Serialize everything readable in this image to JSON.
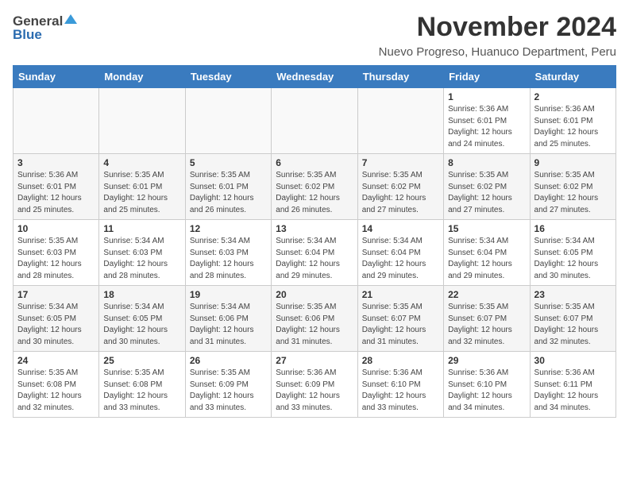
{
  "logo": {
    "general": "General",
    "blue": "Blue"
  },
  "title": "November 2024",
  "location": "Nuevo Progreso, Huanuco Department, Peru",
  "days_of_week": [
    "Sunday",
    "Monday",
    "Tuesday",
    "Wednesday",
    "Thursday",
    "Friday",
    "Saturday"
  ],
  "weeks": [
    [
      {
        "day": "",
        "sunrise": "",
        "sunset": "",
        "daylight": "",
        "empty": true
      },
      {
        "day": "",
        "sunrise": "",
        "sunset": "",
        "daylight": "",
        "empty": true
      },
      {
        "day": "",
        "sunrise": "",
        "sunset": "",
        "daylight": "",
        "empty": true
      },
      {
        "day": "",
        "sunrise": "",
        "sunset": "",
        "daylight": "",
        "empty": true
      },
      {
        "day": "",
        "sunrise": "",
        "sunset": "",
        "daylight": "",
        "empty": true
      },
      {
        "day": "1",
        "sunrise": "Sunrise: 5:36 AM",
        "sunset": "Sunset: 6:01 PM",
        "daylight": "Daylight: 12 hours and 24 minutes."
      },
      {
        "day": "2",
        "sunrise": "Sunrise: 5:36 AM",
        "sunset": "Sunset: 6:01 PM",
        "daylight": "Daylight: 12 hours and 25 minutes."
      }
    ],
    [
      {
        "day": "3",
        "sunrise": "Sunrise: 5:36 AM",
        "sunset": "Sunset: 6:01 PM",
        "daylight": "Daylight: 12 hours and 25 minutes."
      },
      {
        "day": "4",
        "sunrise": "Sunrise: 5:35 AM",
        "sunset": "Sunset: 6:01 PM",
        "daylight": "Daylight: 12 hours and 25 minutes."
      },
      {
        "day": "5",
        "sunrise": "Sunrise: 5:35 AM",
        "sunset": "Sunset: 6:01 PM",
        "daylight": "Daylight: 12 hours and 26 minutes."
      },
      {
        "day": "6",
        "sunrise": "Sunrise: 5:35 AM",
        "sunset": "Sunset: 6:02 PM",
        "daylight": "Daylight: 12 hours and 26 minutes."
      },
      {
        "day": "7",
        "sunrise": "Sunrise: 5:35 AM",
        "sunset": "Sunset: 6:02 PM",
        "daylight": "Daylight: 12 hours and 27 minutes."
      },
      {
        "day": "8",
        "sunrise": "Sunrise: 5:35 AM",
        "sunset": "Sunset: 6:02 PM",
        "daylight": "Daylight: 12 hours and 27 minutes."
      },
      {
        "day": "9",
        "sunrise": "Sunrise: 5:35 AM",
        "sunset": "Sunset: 6:02 PM",
        "daylight": "Daylight: 12 hours and 27 minutes."
      }
    ],
    [
      {
        "day": "10",
        "sunrise": "Sunrise: 5:35 AM",
        "sunset": "Sunset: 6:03 PM",
        "daylight": "Daylight: 12 hours and 28 minutes."
      },
      {
        "day": "11",
        "sunrise": "Sunrise: 5:34 AM",
        "sunset": "Sunset: 6:03 PM",
        "daylight": "Daylight: 12 hours and 28 minutes."
      },
      {
        "day": "12",
        "sunrise": "Sunrise: 5:34 AM",
        "sunset": "Sunset: 6:03 PM",
        "daylight": "Daylight: 12 hours and 28 minutes."
      },
      {
        "day": "13",
        "sunrise": "Sunrise: 5:34 AM",
        "sunset": "Sunset: 6:04 PM",
        "daylight": "Daylight: 12 hours and 29 minutes."
      },
      {
        "day": "14",
        "sunrise": "Sunrise: 5:34 AM",
        "sunset": "Sunset: 6:04 PM",
        "daylight": "Daylight: 12 hours and 29 minutes."
      },
      {
        "day": "15",
        "sunrise": "Sunrise: 5:34 AM",
        "sunset": "Sunset: 6:04 PM",
        "daylight": "Daylight: 12 hours and 29 minutes."
      },
      {
        "day": "16",
        "sunrise": "Sunrise: 5:34 AM",
        "sunset": "Sunset: 6:05 PM",
        "daylight": "Daylight: 12 hours and 30 minutes."
      }
    ],
    [
      {
        "day": "17",
        "sunrise": "Sunrise: 5:34 AM",
        "sunset": "Sunset: 6:05 PM",
        "daylight": "Daylight: 12 hours and 30 minutes."
      },
      {
        "day": "18",
        "sunrise": "Sunrise: 5:34 AM",
        "sunset": "Sunset: 6:05 PM",
        "daylight": "Daylight: 12 hours and 30 minutes."
      },
      {
        "day": "19",
        "sunrise": "Sunrise: 5:34 AM",
        "sunset": "Sunset: 6:06 PM",
        "daylight": "Daylight: 12 hours and 31 minutes."
      },
      {
        "day": "20",
        "sunrise": "Sunrise: 5:35 AM",
        "sunset": "Sunset: 6:06 PM",
        "daylight": "Daylight: 12 hours and 31 minutes."
      },
      {
        "day": "21",
        "sunrise": "Sunrise: 5:35 AM",
        "sunset": "Sunset: 6:07 PM",
        "daylight": "Daylight: 12 hours and 31 minutes."
      },
      {
        "day": "22",
        "sunrise": "Sunrise: 5:35 AM",
        "sunset": "Sunset: 6:07 PM",
        "daylight": "Daylight: 12 hours and 32 minutes."
      },
      {
        "day": "23",
        "sunrise": "Sunrise: 5:35 AM",
        "sunset": "Sunset: 6:07 PM",
        "daylight": "Daylight: 12 hours and 32 minutes."
      }
    ],
    [
      {
        "day": "24",
        "sunrise": "Sunrise: 5:35 AM",
        "sunset": "Sunset: 6:08 PM",
        "daylight": "Daylight: 12 hours and 32 minutes."
      },
      {
        "day": "25",
        "sunrise": "Sunrise: 5:35 AM",
        "sunset": "Sunset: 6:08 PM",
        "daylight": "Daylight: 12 hours and 33 minutes."
      },
      {
        "day": "26",
        "sunrise": "Sunrise: 5:35 AM",
        "sunset": "Sunset: 6:09 PM",
        "daylight": "Daylight: 12 hours and 33 minutes."
      },
      {
        "day": "27",
        "sunrise": "Sunrise: 5:36 AM",
        "sunset": "Sunset: 6:09 PM",
        "daylight": "Daylight: 12 hours and 33 minutes."
      },
      {
        "day": "28",
        "sunrise": "Sunrise: 5:36 AM",
        "sunset": "Sunset: 6:10 PM",
        "daylight": "Daylight: 12 hours and 33 minutes."
      },
      {
        "day": "29",
        "sunrise": "Sunrise: 5:36 AM",
        "sunset": "Sunset: 6:10 PM",
        "daylight": "Daylight: 12 hours and 34 minutes."
      },
      {
        "day": "30",
        "sunrise": "Sunrise: 5:36 AM",
        "sunset": "Sunset: 6:11 PM",
        "daylight": "Daylight: 12 hours and 34 minutes."
      }
    ]
  ]
}
